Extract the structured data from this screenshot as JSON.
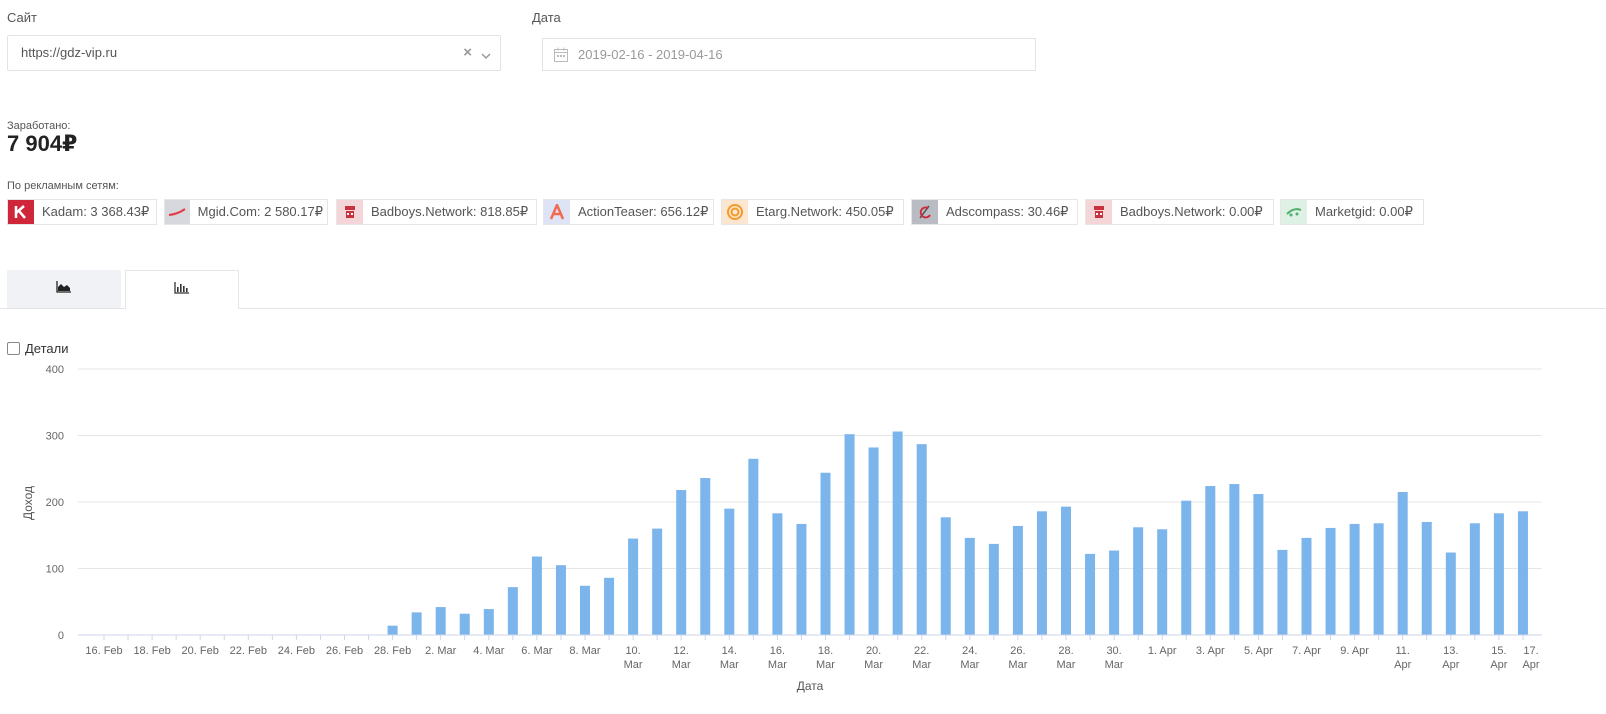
{
  "filters": {
    "site_label": "Сайт",
    "site_value": "https://gdz-vip.ru",
    "date_label": "Дата",
    "date_value": "2019-02-16 - 2019-04-16"
  },
  "summary": {
    "earned_label": "Заработано:",
    "earned_value": "7 904₽",
    "networks_label": "По рекламным сетям:",
    "networks": [
      {
        "text": "Kadam: 3 368.43₽",
        "icon": "kadam-logo",
        "color": "#d0263a"
      },
      {
        "text": "Mgid.Com: 2 580.17₽",
        "icon": "mgid-logo",
        "color": "#e53945"
      },
      {
        "text": "Badboys.Network: 818.85₽",
        "icon": "badboys-logo",
        "color": "#c8323e"
      },
      {
        "text": "ActionTeaser: 656.12₽",
        "icon": "actionteaser-logo",
        "color": "#f06a4f"
      },
      {
        "text": "Etarg.Network: 450.05₽",
        "icon": "etarg-logo",
        "color": "#f39a2b"
      },
      {
        "text": "Adscompass: 30.46₽",
        "icon": "adscompass-logo",
        "color": "#7a7f86"
      },
      {
        "text": "Badboys.Network: 0.00₽",
        "icon": "badboys-logo",
        "color": "#c8323e"
      },
      {
        "text": "Marketgid: 0.00₽",
        "icon": "marketgid-logo",
        "color": "#4caf6a"
      }
    ]
  },
  "tabs": [
    {
      "icon": "area-chart-icon",
      "active": false
    },
    {
      "icon": "bar-chart-icon",
      "active": true
    }
  ],
  "details_label": "Детали",
  "chart_data": {
    "type": "bar",
    "xlabel": "Дата",
    "ylabel": "Доход",
    "ylim": [
      0,
      400
    ],
    "yticks": [
      0,
      100,
      200,
      300,
      400
    ],
    "grid": true,
    "bar_color": "#7cb5ec",
    "x": [
      "2019-02-16",
      "2019-02-17",
      "2019-02-18",
      "2019-02-19",
      "2019-02-20",
      "2019-02-21",
      "2019-02-22",
      "2019-02-23",
      "2019-02-24",
      "2019-02-25",
      "2019-02-26",
      "2019-02-27",
      "2019-02-28",
      "2019-03-01",
      "2019-03-02",
      "2019-03-03",
      "2019-03-04",
      "2019-03-05",
      "2019-03-06",
      "2019-03-07",
      "2019-03-08",
      "2019-03-09",
      "2019-03-10",
      "2019-03-11",
      "2019-03-12",
      "2019-03-13",
      "2019-03-14",
      "2019-03-15",
      "2019-03-16",
      "2019-03-17",
      "2019-03-18",
      "2019-03-19",
      "2019-03-20",
      "2019-03-21",
      "2019-03-22",
      "2019-03-23",
      "2019-03-24",
      "2019-03-25",
      "2019-03-26",
      "2019-03-27",
      "2019-03-28",
      "2019-03-29",
      "2019-03-30",
      "2019-03-31",
      "2019-04-01",
      "2019-04-02",
      "2019-04-03",
      "2019-04-04",
      "2019-04-05",
      "2019-04-06",
      "2019-04-07",
      "2019-04-08",
      "2019-04-09",
      "2019-04-10",
      "2019-04-11",
      "2019-04-12",
      "2019-04-13",
      "2019-04-14",
      "2019-04-15",
      "2019-04-16"
    ],
    "values": [
      0,
      0,
      0,
      0,
      0,
      0,
      0,
      0,
      0,
      0,
      0,
      0,
      14,
      34,
      42,
      32,
      39,
      72,
      118,
      105,
      74,
      86,
      145,
      160,
      218,
      236,
      190,
      265,
      183,
      167,
      244,
      302,
      282,
      306,
      287,
      177,
      146,
      137,
      164,
      186,
      193,
      122,
      127,
      162,
      159,
      202,
      224,
      227,
      212,
      128,
      146,
      161,
      167,
      168,
      215,
      170,
      124,
      168,
      183,
      186
    ],
    "x_tick_labels": [
      {
        "i": 0,
        "lines": [
          "16. Feb"
        ]
      },
      {
        "i": 2,
        "lines": [
          "18. Feb"
        ]
      },
      {
        "i": 4,
        "lines": [
          "20. Feb"
        ]
      },
      {
        "i": 6,
        "lines": [
          "22. Feb"
        ]
      },
      {
        "i": 8,
        "lines": [
          "24. Feb"
        ]
      },
      {
        "i": 10,
        "lines": [
          "26. Feb"
        ]
      },
      {
        "i": 12,
        "lines": [
          "28. Feb"
        ]
      },
      {
        "i": 14,
        "lines": [
          "2. Mar"
        ]
      },
      {
        "i": 16,
        "lines": [
          "4. Mar"
        ]
      },
      {
        "i": 18,
        "lines": [
          "6. Mar"
        ]
      },
      {
        "i": 20,
        "lines": [
          "8. Mar"
        ]
      },
      {
        "i": 22,
        "lines": [
          "10.",
          "Mar"
        ]
      },
      {
        "i": 24,
        "lines": [
          "12.",
          "Mar"
        ]
      },
      {
        "i": 26,
        "lines": [
          "14.",
          "Mar"
        ]
      },
      {
        "i": 28,
        "lines": [
          "16.",
          "Mar"
        ]
      },
      {
        "i": 30,
        "lines": [
          "18.",
          "Mar"
        ]
      },
      {
        "i": 32,
        "lines": [
          "20.",
          "Mar"
        ]
      },
      {
        "i": 34,
        "lines": [
          "22.",
          "Mar"
        ]
      },
      {
        "i": 36,
        "lines": [
          "24.",
          "Mar"
        ]
      },
      {
        "i": 38,
        "lines": [
          "26.",
          "Mar"
        ]
      },
      {
        "i": 40,
        "lines": [
          "28.",
          "Mar"
        ]
      },
      {
        "i": 42,
        "lines": [
          "30.",
          "Mar"
        ]
      },
      {
        "i": 44,
        "lines": [
          "1. Apr"
        ]
      },
      {
        "i": 46,
        "lines": [
          "3. Apr"
        ]
      },
      {
        "i": 48,
        "lines": [
          "5. Apr"
        ]
      },
      {
        "i": 50,
        "lines": [
          "7. Apr"
        ]
      },
      {
        "i": 52,
        "lines": [
          "9. Apr"
        ]
      },
      {
        "i": 54,
        "lines": [
          "11.",
          "Apr"
        ]
      },
      {
        "i": 56,
        "lines": [
          "13.",
          "Apr"
        ]
      },
      {
        "i": 58,
        "lines": [
          "15.",
          "Apr"
        ]
      },
      {
        "i": 60,
        "lines": [
          "17.",
          "Apr"
        ]
      }
    ]
  }
}
